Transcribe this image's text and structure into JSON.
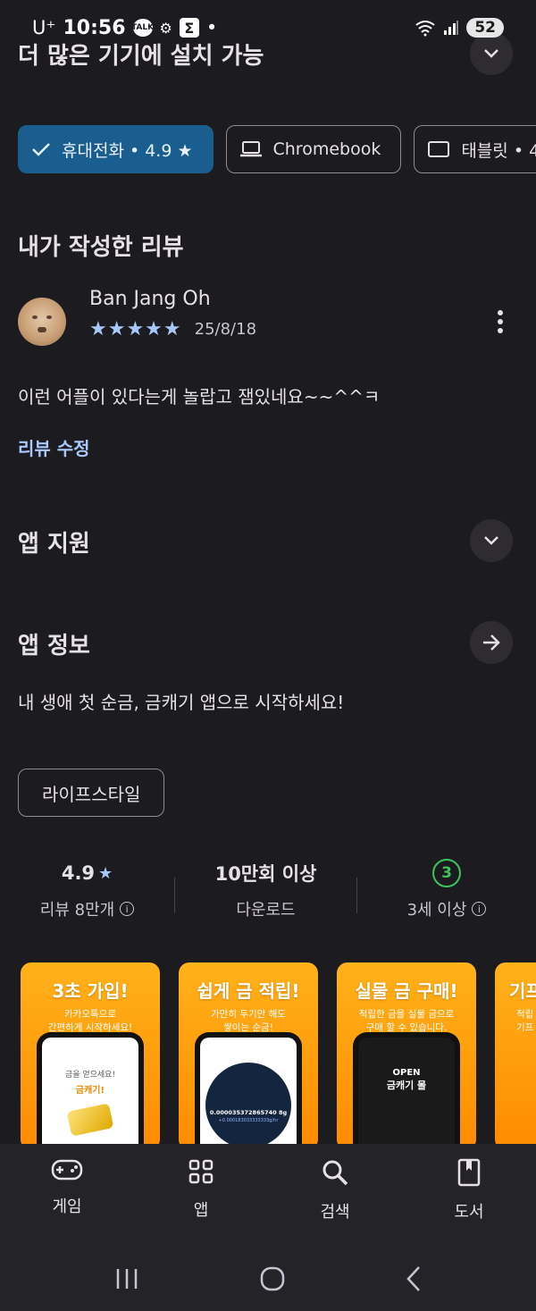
{
  "status": {
    "carrier": "U⁺",
    "time": "10:56",
    "talk_badge": "TALK",
    "sigma": "Σ",
    "dot": "•",
    "battery": "52"
  },
  "compat": {
    "title": "더 많은 기기에 설치 가능"
  },
  "device_chips": [
    {
      "label": "휴대전화 • 4.9 ★",
      "selected": true,
      "icon": "check-icon"
    },
    {
      "label": "Chromebook",
      "selected": false,
      "icon": "laptop-icon"
    },
    {
      "label": "태블릿 • 4",
      "selected": false,
      "icon": "tablet-icon"
    }
  ],
  "my_review": {
    "section_title": "내가 작성한 리뷰",
    "author": "Ban Jang Oh",
    "rating": 5,
    "stars_text": "★★★★★",
    "date": "25/8/18",
    "text": "이런 어플이 있다는게 놀랍고 잼있네요~~^^ㅋ",
    "edit_label": "리뷰 수정"
  },
  "app_support": {
    "title": "앱 지원"
  },
  "app_info": {
    "title": "앱 정보",
    "description": "내 생애 첫 순금, 금캐기 앱으로 시작하세요!",
    "category": "라이프스타일"
  },
  "stats": {
    "rating_value": "4.9",
    "rating_star": "★",
    "reviews_label": "리뷰 8만개",
    "downloads_value": "10만회 이상",
    "downloads_label": "다운로드",
    "age_value": "3",
    "age_label": "3세 이상",
    "info_glyph": "i"
  },
  "screenshots": [
    {
      "headline": "3초 가입!",
      "sub1": "카카오톡으로",
      "sub2": "간편하게 시작하세요!",
      "screen_line1": "금을 얻으세요!",
      "screen_line2": "금캐기!"
    },
    {
      "headline": "쉽게 금 적립!",
      "sub1": "가만히 두기만 해도",
      "sub2": "쌓이는 순금!",
      "screen_line1": "0.000035372865740 8g",
      "screen_line2": "+0.000183033333333g/hr"
    },
    {
      "headline": "실물 금 구매!",
      "sub1": "적립한 금을 실물 금으로",
      "sub2": "구매 할 수 있습니다.",
      "screen_line1": "OPEN",
      "screen_line2": "금캐기 몰"
    },
    {
      "headline": "기프",
      "sub1": "적립",
      "sub2": "기프",
      "screen_line1": "",
      "screen_line2": ""
    }
  ],
  "bottom_nav": [
    {
      "label": "게임",
      "icon": "gamepad-icon"
    },
    {
      "label": "앱",
      "icon": "apps-grid-icon"
    },
    {
      "label": "검색",
      "icon": "search-icon"
    },
    {
      "label": "도서",
      "icon": "book-icon"
    }
  ],
  "colors": {
    "background": "#1c1b1f",
    "selected_chip": "#1a5d8f",
    "star": "#a8c7fa",
    "link": "#a8c7fa",
    "age_badge": "#3ec45c",
    "screenshot_orange": "#ff9800"
  }
}
